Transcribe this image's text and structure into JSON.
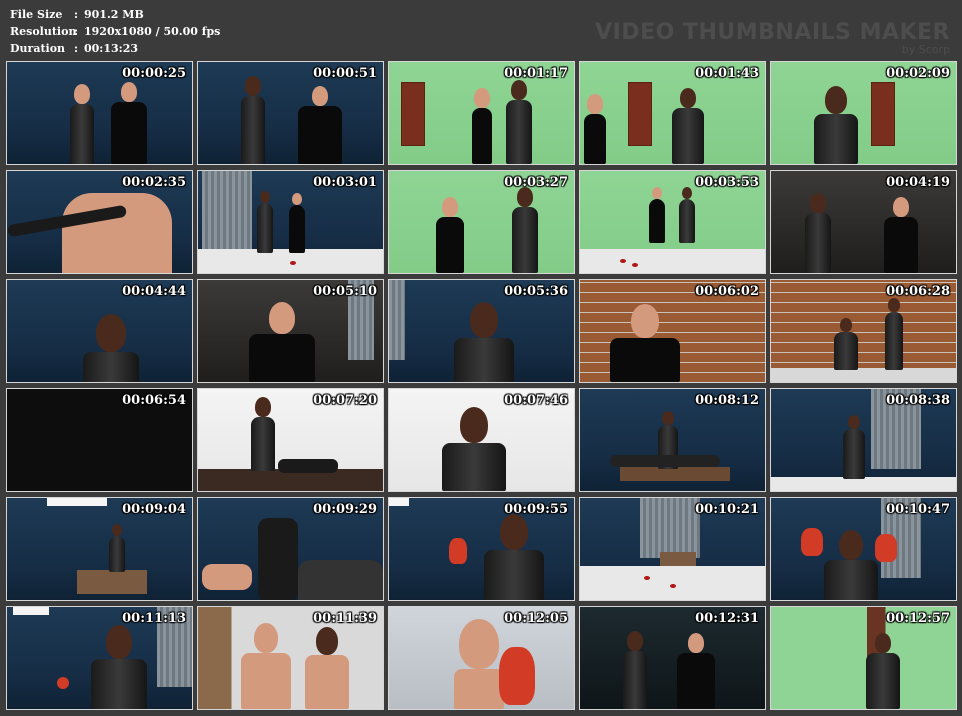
{
  "meta": {
    "file_size_label": "File Size",
    "file_size_value": "901.2 MB",
    "resolution_label": "Resolution",
    "resolution_value": "1920x1080 / 50.00 fps",
    "duration_label": "Duration",
    "duration_value": "00:13:23",
    "separator": ":"
  },
  "brand": {
    "title": "VIDEO THUMBNAILS MAKER",
    "subtitle": "by Scorp"
  },
  "colors": {
    "background": "#3b3b3b",
    "text": "#ffffff",
    "brand_text": "#4d4d4d",
    "thumb_border": "#d6d6d6"
  },
  "thumbnails": [
    {
      "time": "00:00:25",
      "scene": "blue-room, woman in catsuit beside man in tank top"
    },
    {
      "time": "00:00:51",
      "scene": "blue-room, woman touches man's face"
    },
    {
      "time": "00:01:17",
      "scene": "green-wall, man and woman facing each other"
    },
    {
      "time": "00:01:43",
      "scene": "green-wall, woman raises hand"
    },
    {
      "time": "00:02:09",
      "scene": "green-wall, woman closeup raising hand"
    },
    {
      "time": "00:02:35",
      "scene": "blue-room, gloved hand on man's shoulder"
    },
    {
      "time": "00:03:01",
      "scene": "white-floor room with curtain, two figures, blood on floor"
    },
    {
      "time": "00:03:27",
      "scene": "green-wall, man and woman in stance"
    },
    {
      "time": "00:03:53",
      "scene": "green-wall, two figures, blood on floor"
    },
    {
      "time": "00:04:19",
      "scene": "dark room, woman and man standing"
    },
    {
      "time": "00:04:44",
      "scene": "blue-room, woman closeup raising hand"
    },
    {
      "time": "00:05:10",
      "scene": "room with curtain, man in tank top and cap"
    },
    {
      "time": "00:05:36",
      "scene": "blue-room, woman gesturing with both hands"
    },
    {
      "time": "00:06:02",
      "scene": "brick wall, man leaning with eyes closed"
    },
    {
      "time": "00:06:28",
      "scene": "brick wall, woman kicking, person seated"
    },
    {
      "time": "00:06:54",
      "scene": "black frame"
    },
    {
      "time": "00:07:20",
      "scene": "white room, woman over man lying on couch"
    },
    {
      "time": "00:07:46",
      "scene": "white room, woman raising hand"
    },
    {
      "time": "00:08:12",
      "scene": "blue-room, woman over man on desk"
    },
    {
      "time": "00:08:38",
      "scene": "blue-room with curtain, woman crouching"
    },
    {
      "time": "00:09:04",
      "scene": "blue-room, figure on desk"
    },
    {
      "time": "00:09:29",
      "scene": "blue-room, closeup of boots and hand"
    },
    {
      "time": "00:09:55",
      "scene": "blue-room, woman with red hand"
    },
    {
      "time": "00:10:21",
      "scene": "room with curtain, desk, blood on floor"
    },
    {
      "time": "00:10:47",
      "scene": "blue-room, woman raising red hands"
    },
    {
      "time": "00:11:13",
      "scene": "blue-room, woman holding red object"
    },
    {
      "time": "00:11:39",
      "scene": "shower, man and woman"
    },
    {
      "time": "00:12:05",
      "scene": "shower, woman with red hand closeup"
    },
    {
      "time": "00:12:31",
      "scene": "dark room, woman and man, subtitle"
    },
    {
      "time": "00:12:57",
      "scene": "green-wall, woman gesturing, subtitle"
    }
  ]
}
